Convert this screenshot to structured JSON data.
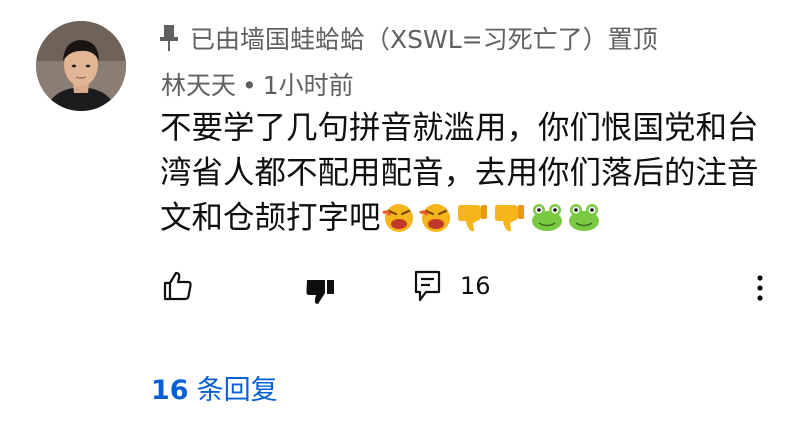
{
  "comment": {
    "pinned_text": "已由墙国蛙蛤蛤（XSWL=习死亡了）置顶",
    "author": "林天天",
    "separator": "•",
    "time": "1小时前",
    "body_text": "不要学了几句拼音就滥用，你们恨国党和台湾省人都不配用配音，去用你们落后的注音文和仓颉打字吧",
    "emojis": [
      "angry-face-emoji",
      "angry-face-emoji",
      "thumbs-down-emoji",
      "thumbs-down-emoji",
      "frog-emoji",
      "frog-emoji"
    ]
  },
  "actions": {
    "like_icon": "thumbs-up-outline-icon",
    "dislike_icon": "thumbs-down-filled-icon",
    "reply_icon": "comment-icon",
    "reply_count": "16",
    "more_icon": "more-vertical-icon"
  },
  "replies": {
    "count": "16",
    "label": "条回复"
  },
  "colors": {
    "primary_text": "#0f0f0f",
    "secondary_text": "#606060",
    "link": "#065fd4",
    "background": "#ffffff"
  }
}
